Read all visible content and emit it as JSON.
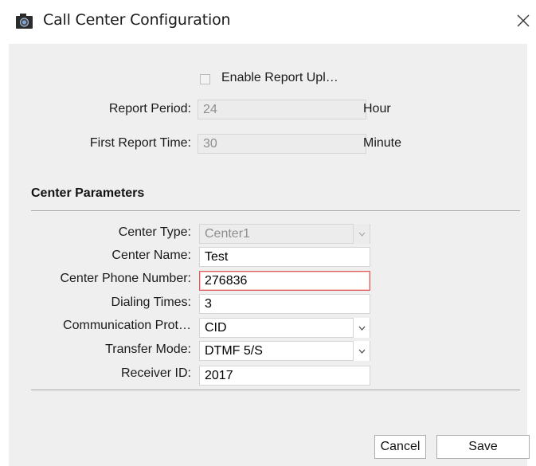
{
  "window": {
    "title": "Call Center Configuration",
    "close_icon": "close-icon",
    "app_icon": "camera-icon"
  },
  "report": {
    "enable_upload_label": "Enable Report Upl…",
    "enable_upload_checked": false,
    "report_period_label": "Report Period:",
    "report_period_value": "24",
    "report_period_unit": "Hour",
    "first_report_time_label": "First Report Time:",
    "first_report_time_value": "30",
    "first_report_time_unit": "Minute"
  },
  "center": {
    "section_title": "Center Parameters",
    "center_type_label": "Center Type:",
    "center_type_value": "Center1",
    "center_name_label": "Center Name:",
    "center_name_value": "Test",
    "phone_label": "Center Phone Number:",
    "phone_value": "276836",
    "dialing_times_label": "Dialing Times:",
    "dialing_times_value": "3",
    "protocol_label": "Communication Prot…",
    "protocol_value": "CID",
    "transfer_mode_label": "Transfer Mode:",
    "transfer_mode_value": "DTMF 5/S",
    "receiver_id_label": "Receiver ID:",
    "receiver_id_value": "2017"
  },
  "buttons": {
    "cancel": "Cancel",
    "save": "Save"
  },
  "colors": {
    "panel_bg": "#efefef",
    "focus_border": "#e05a5a",
    "disabled_bg": "#ececec"
  }
}
